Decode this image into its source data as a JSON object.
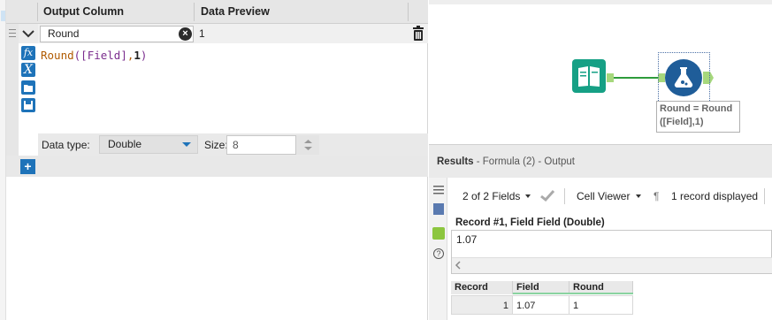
{
  "formula_grid": {
    "headers": {
      "output_column": "Output Column",
      "data_preview": "Data Preview"
    },
    "row": {
      "output_column_value": "Round",
      "preview_value": "1"
    },
    "expression": {
      "func": "Round",
      "open": "(",
      "field": "[Field]",
      "comma": ",",
      "arg": "1",
      "close": ")"
    },
    "tool_buttons": [
      "fx-icon",
      "variable-icon",
      "open-icon",
      "save-icon"
    ],
    "data_type_label": "Data type:",
    "data_type_value": "Double",
    "size_label": "Size:",
    "size_value": "8"
  },
  "canvas": {
    "formula_tool_label": "Round = Round ([Field],1)",
    "colors": {
      "input_tool": "#16a085",
      "formula_tool": "#1f5d99",
      "connector": "#2e9c3b"
    }
  },
  "results": {
    "title": "Results",
    "subtitle": "- Formula (2) - Output",
    "fields_count": "2 of 2 Fields",
    "viewer": "Cell Viewer",
    "records_displayed": "1 record displayed",
    "record_header": "Record #1, Field Field (Double)",
    "record_value": "1.07",
    "table": {
      "columns": [
        "Record",
        "Field",
        "Round"
      ],
      "rows": [
        [
          "1",
          "1.07",
          "1"
        ]
      ]
    }
  }
}
